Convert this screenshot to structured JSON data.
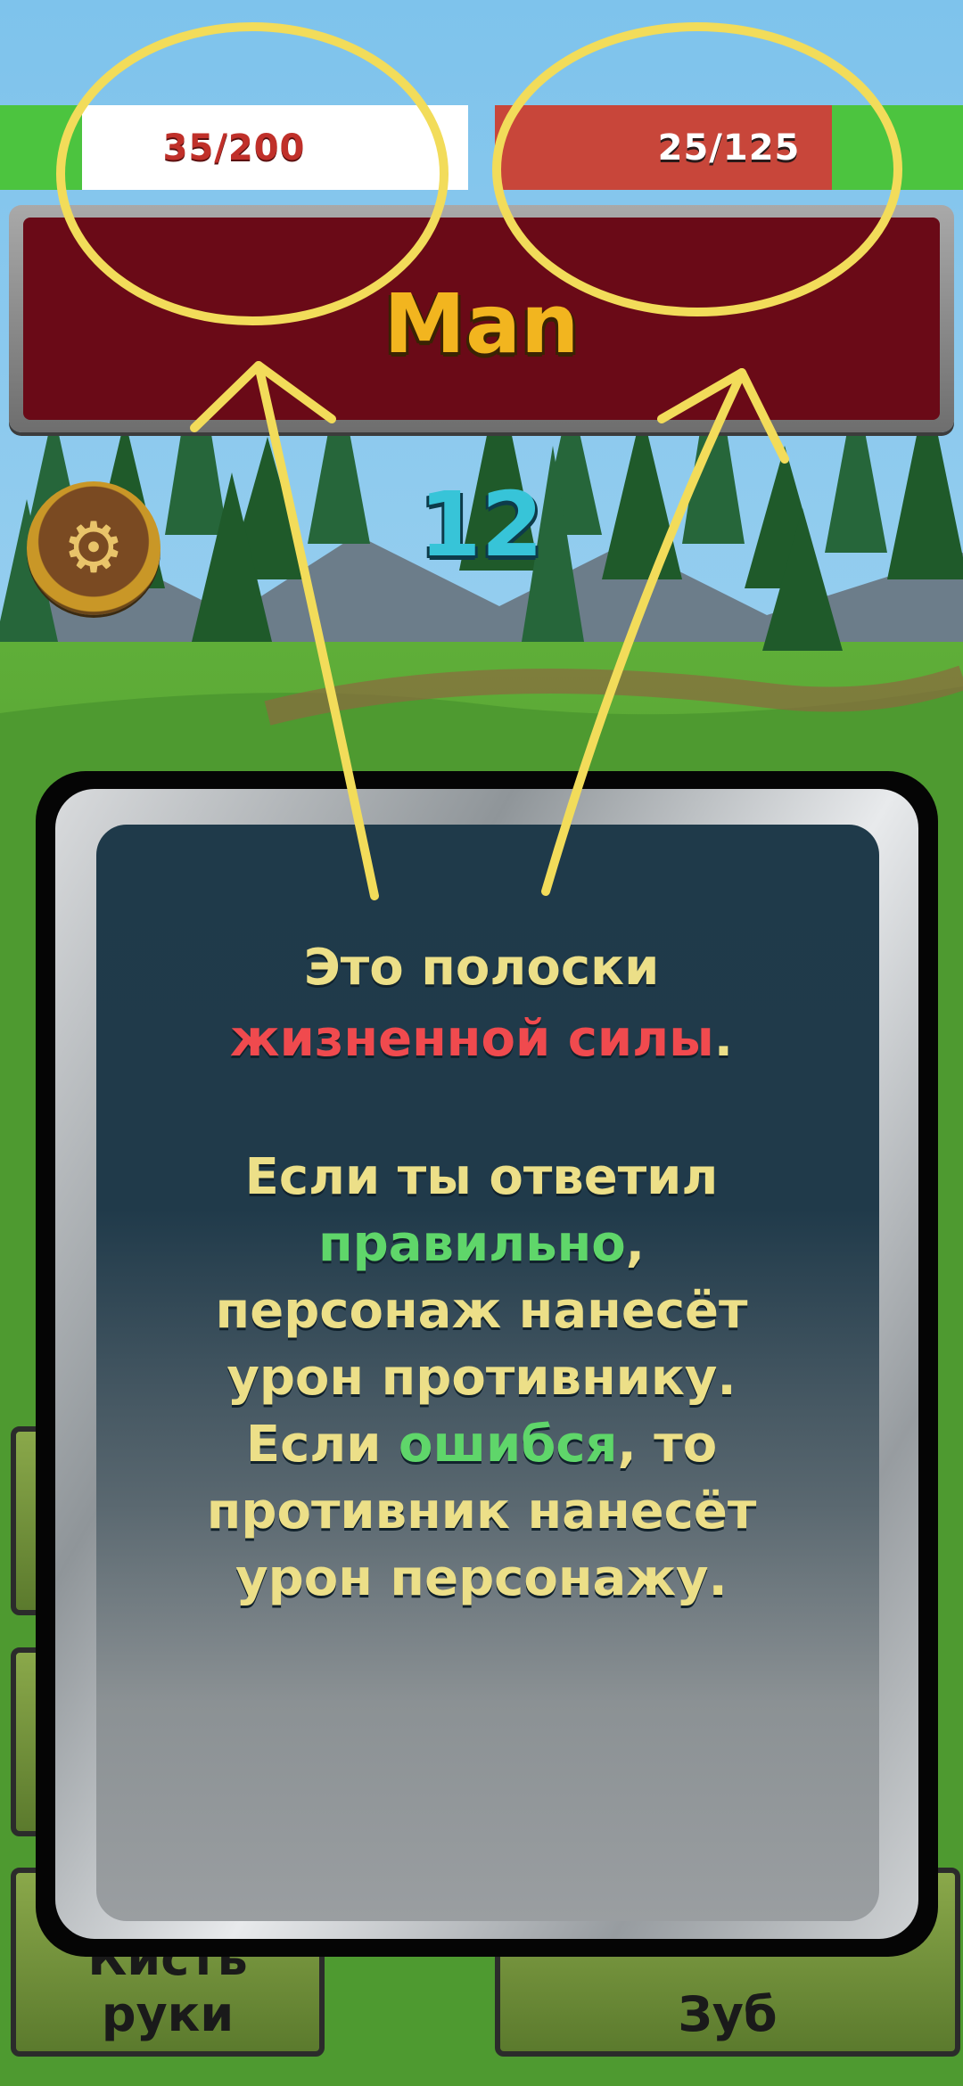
{
  "player_hp": {
    "text": "35/200",
    "current": 35,
    "max": 200
  },
  "enemy_hp": {
    "text": "25/125",
    "current": 25,
    "max": 125
  },
  "enemy_name": "Man",
  "timer": "12",
  "settings_icon": "gear-icon",
  "answers": {
    "bottom_left": "Кисть руки",
    "bottom_right": "Зуб"
  },
  "tutorial": {
    "line1": "Это полоски",
    "line2_red": "жизненной силы",
    "line2_end": ".",
    "line3": "Если ты ответил",
    "line4_green": "правильно",
    "line4_end": ",",
    "line5": "персонаж нанесёт",
    "line6": "урон противнику.",
    "line7_start": "Если ",
    "line7_green": "ошибся",
    "line7_end": ", то",
    "line8": "противник нанесёт",
    "line9": "урон персонажу."
  },
  "colors": {
    "highlight": "#f2dc5a",
    "hp_green": "#4cc43f",
    "hp_red": "#c8463a",
    "banner": "#6a0a17",
    "text_yellow": "#ecdf88",
    "text_red": "#f04a4e",
    "text_green": "#5fd66a"
  }
}
